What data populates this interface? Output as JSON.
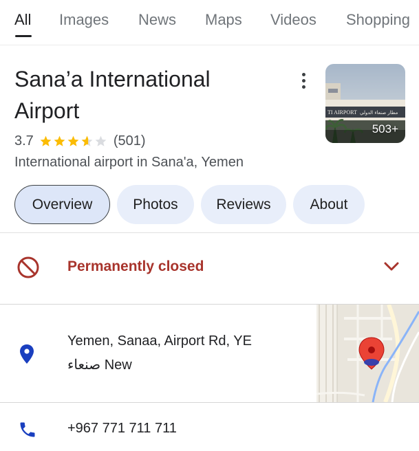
{
  "tabs": [
    {
      "label": "All"
    },
    {
      "label": "Images"
    },
    {
      "label": "News"
    },
    {
      "label": "Maps"
    },
    {
      "label": "Videos"
    },
    {
      "label": "Shopping"
    }
  ],
  "place": {
    "title_line1": "Sana’a International",
    "title_line2": "Airport",
    "rating": "3.7",
    "rating_value": 3.7,
    "review_count": "(501)",
    "subtitle": "International airport in Sana'a, Yemen",
    "photo_count": "503+",
    "photo_sign_text": "مطار صنعاء الدولي  ...L AIRPORT"
  },
  "chips": [
    {
      "label": "Overview"
    },
    {
      "label": "Photos"
    },
    {
      "label": "Reviews"
    },
    {
      "label": "About"
    }
  ],
  "status": {
    "label": "Permanently closed",
    "color": "#a8342c"
  },
  "address": {
    "line1": "Yemen, Sanaa, Airport Rd, YE",
    "line2": "صنعاء New"
  },
  "phone": {
    "number": "+967 771 711 711"
  },
  "colors": {
    "accent_blue": "#1a3fbf",
    "star": "#fbbc04",
    "chip_bg": "#e8eefa",
    "map_pin": "#ea4335"
  },
  "icons": {
    "more": "more-vert-icon",
    "closed": "block-icon",
    "expand": "chevron-down-icon",
    "location": "location-pin-icon",
    "phone": "phone-icon"
  }
}
